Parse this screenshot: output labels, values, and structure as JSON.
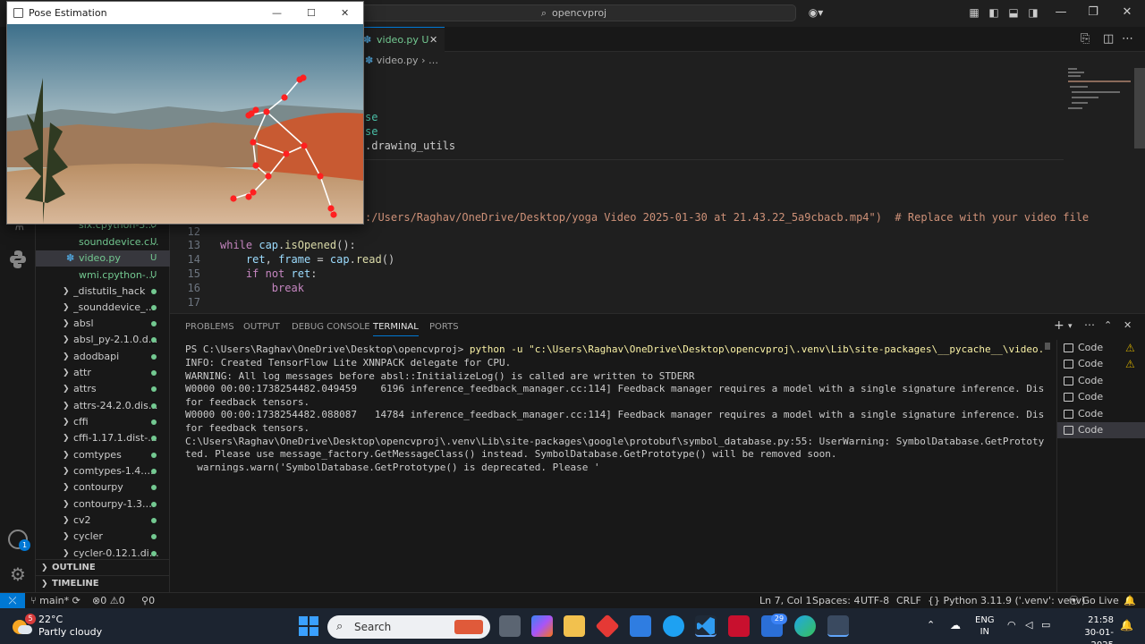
{
  "titlebar": {
    "search_text": "opencvproj"
  },
  "editor": {
    "tab": {
      "label": "video.py U",
      "icon": "python-file-icon"
    },
    "breadcrumb": {
      "file": "video.py",
      "more": "…"
    },
    "partial_lines": [
      "se",
      "se",
      ".drawing_utils"
    ],
    "line_11_visible": ":/Users/Raghav/OneDrive/Desktop/yoga Video 2025-01-30 at 21.43.22_5a9cbacb.mp4\")  # Replace with your video file",
    "lines": [
      {
        "num": "12",
        "text": ""
      },
      {
        "num": "13",
        "text": "while cap.isOpened():"
      },
      {
        "num": "14",
        "text": "    ret, frame = cap.read()"
      },
      {
        "num": "15",
        "text": "    if not ret:"
      },
      {
        "num": "16",
        "text": "        break"
      },
      {
        "num": "17",
        "text": ""
      }
    ]
  },
  "sidebar": {
    "items": [
      {
        "label": "six.cpython-3...",
        "status": "U",
        "kind": "file"
      },
      {
        "label": "sounddevice.c...",
        "status": "U",
        "kind": "file"
      },
      {
        "label": "video.py",
        "status": "U",
        "kind": "file",
        "selected": true
      },
      {
        "label": "wmi.cpython-...",
        "status": "U",
        "kind": "file"
      },
      {
        "label": "_distutils_hack",
        "kind": "folder"
      },
      {
        "label": "_sounddevice_...",
        "kind": "folder"
      },
      {
        "label": "absl",
        "kind": "folder"
      },
      {
        "label": "absl_py-2.1.0.d...",
        "kind": "folder"
      },
      {
        "label": "adodbapi",
        "kind": "folder"
      },
      {
        "label": "attr",
        "kind": "folder"
      },
      {
        "label": "attrs",
        "kind": "folder"
      },
      {
        "label": "attrs-24.2.0.dis...",
        "kind": "folder"
      },
      {
        "label": "cffi",
        "kind": "folder"
      },
      {
        "label": "cffi-1.17.1.dist-...",
        "kind": "folder"
      },
      {
        "label": "comtypes",
        "kind": "folder"
      },
      {
        "label": "comtypes-1.4.7.dist-i...",
        "kind": "folder"
      },
      {
        "label": "contourpy",
        "kind": "folder"
      },
      {
        "label": "contourpy-1.3.0.dist-...",
        "kind": "folder"
      },
      {
        "label": "cv2",
        "kind": "folder"
      },
      {
        "label": "cycler",
        "kind": "folder"
      },
      {
        "label": "cycler-0.12.1.dist-info",
        "kind": "folder"
      }
    ],
    "outline": "OUTLINE",
    "timeline": "TIMELINE",
    "accounts_badge": "1"
  },
  "panel": {
    "tabs": [
      "PROBLEMS",
      "OUTPUT",
      "DEBUG CONSOLE",
      "TERMINAL",
      "PORTS"
    ],
    "active_tab": "TERMINAL",
    "prompt": "PS C:\\Users\\Raghav\\OneDrive\\Desktop\\opencvproj> ",
    "command": "python -u \"c:\\Users\\Raghav\\OneDrive\\Desktop\\opencvproj\\.venv\\Lib\\site-packages\\__pycache__\\video.py\"",
    "output": [
      "INFO: Created TensorFlow Lite XNNPACK delegate for CPU.",
      "WARNING: All log messages before absl::InitializeLog() is called are written to STDERR",
      "W0000 00:00:1738254482.049459    6196 inference_feedback_manager.cc:114] Feedback manager requires a model with a single signature inference. Disabling support",
      "for feedback tensors.",
      "W0000 00:00:1738254482.088087   14784 inference_feedback_manager.cc:114] Feedback manager requires a model with a single signature inference. Disabling support",
      "for feedback tensors.",
      "C:\\Users\\Raghav\\OneDrive\\Desktop\\opencvproj\\.venv\\Lib\\site-packages\\google\\protobuf\\symbol_database.py:55: UserWarning: SymbolDatabase.GetPrototype() is depreca",
      "ted. Please use message_factory.GetMessageClass() instead. SymbolDatabase.GetPrototype() will be removed soon.",
      "  warnings.warn('SymbolDatabase.GetPrototype() is deprecated. Please '"
    ],
    "terminals": [
      {
        "label": "Code",
        "warn": true
      },
      {
        "label": "Code",
        "warn": true
      },
      {
        "label": "Code"
      },
      {
        "label": "Code"
      },
      {
        "label": "Code"
      },
      {
        "label": "Code",
        "selected": true
      }
    ]
  },
  "statusbar": {
    "branch": "main*",
    "errors": "0",
    "warnings": "0",
    "ports": "0",
    "position": "Ln 7, Col 1",
    "spaces": "Spaces: 4",
    "encoding": "UTF-8",
    "eol": "CRLF",
    "language": "Python",
    "interpreter": "3.11.9 ('.venv': venv)",
    "golive": "Go Live"
  },
  "pose_window": {
    "title": "Pose Estimation"
  },
  "taskbar": {
    "weather_temp": "22°C",
    "weather_desc": "Partly cloudy",
    "weather_badge": "5",
    "search_label": "Search",
    "store_badge": "29",
    "lang_top": "ENG",
    "lang_bottom": "IN",
    "time": "21:58",
    "date": "30-01-2025"
  },
  "colors": {
    "accent": "#0078d4",
    "git_untracked": "#73c991",
    "warning": "#cca700",
    "pose_landmark": "#ff2020"
  }
}
